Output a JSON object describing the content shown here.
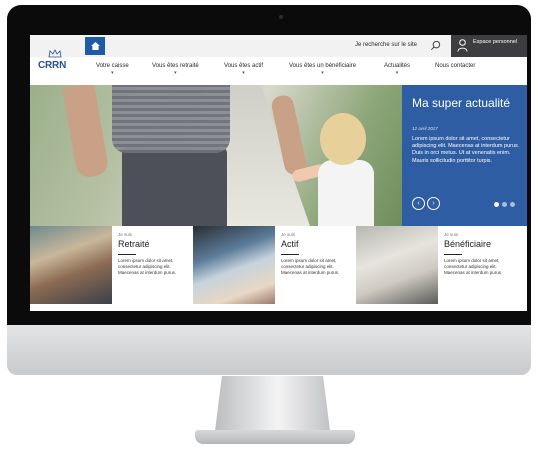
{
  "topbar": {
    "search_placeholder": "Je recherche sur le site",
    "account_label": "Espace personnel"
  },
  "logo": {
    "text": "CRRN"
  },
  "nav": {
    "items": [
      {
        "label": "Votre caisse"
      },
      {
        "label": "Vous êtes retraité"
      },
      {
        "label": "Vous êtes actif"
      },
      {
        "label": "Vous êtes un bénéficiaire"
      },
      {
        "label": "Actualités"
      },
      {
        "label": "Nous contacter"
      }
    ]
  },
  "hero": {
    "news_title": "Ma super actualité",
    "news_date": "12 avril 2017",
    "news_body": "Lorem ipsum dolor sit amet, consectetur adipiscing elit. Maecenas at interdum purus. Duis in orci metus. Ut at venenatis enim. Mauris sollicitudin porttitor turpis.",
    "prev_label": "‹",
    "next_label": "›",
    "slides": 3,
    "active_slide": 1
  },
  "cards": [
    {
      "kicker": "Je suis",
      "title": "Retraité",
      "text": "Lorem ipsum dolor sit amet, consectetur adipiscing elit. Maecenas at interdum purus."
    },
    {
      "kicker": "Je suis",
      "title": "Actif",
      "text": "Lorem ipsum dolor sit amet, consectetur adipiscing elit. Maecenas at interdum purus."
    },
    {
      "kicker": "Je suis",
      "title": "Bénéficiaire",
      "text": "Lorem ipsum dolor sit amet, consectetur adipiscing elit. Maecenas at interdum purus."
    }
  ],
  "colors": {
    "brand_blue": "#2f5da3",
    "home_blue": "#1f5aa6",
    "account_dark": "#3d3d40"
  },
  "icons": [
    "home-icon",
    "search-icon",
    "user-icon",
    "chevron-left-icon",
    "chevron-right-icon"
  ]
}
